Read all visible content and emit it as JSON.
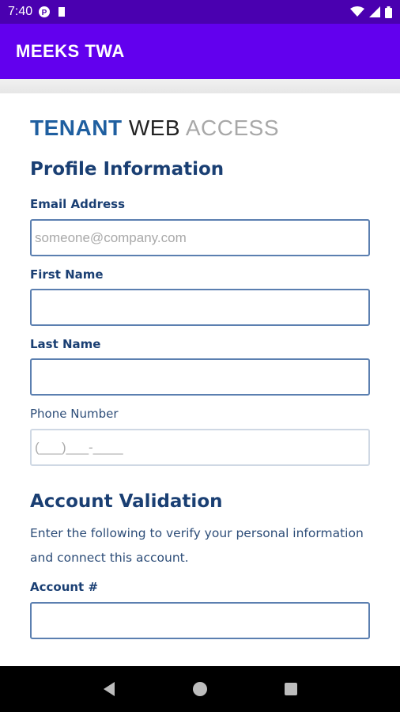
{
  "status_bar": {
    "time": "7:40",
    "icons_left": [
      "p-icon",
      "sd-card-icon"
    ],
    "icons_right": [
      "wifi-icon",
      "signal-icon",
      "battery-icon"
    ]
  },
  "app_bar": {
    "title": "MEEKS TWA",
    "color": "#6200ee"
  },
  "logo": {
    "part1": "TENANT",
    "part2": "WEB",
    "part3": "ACCESS"
  },
  "profile": {
    "title": "Profile Information",
    "email_label": "Email Address",
    "email_placeholder": "someone@company.com",
    "first_name_label": "First Name",
    "last_name_label": "Last Name",
    "phone_label": "Phone Number",
    "phone_placeholder": "(___)___-____"
  },
  "validation": {
    "title": "Account Validation",
    "description_line1": "Enter the following to verify your personal information",
    "description_line2": "and connect this account.",
    "account_label": "Account #"
  },
  "nav": {
    "buttons": [
      "back-icon",
      "home-icon",
      "recents-icon"
    ]
  }
}
